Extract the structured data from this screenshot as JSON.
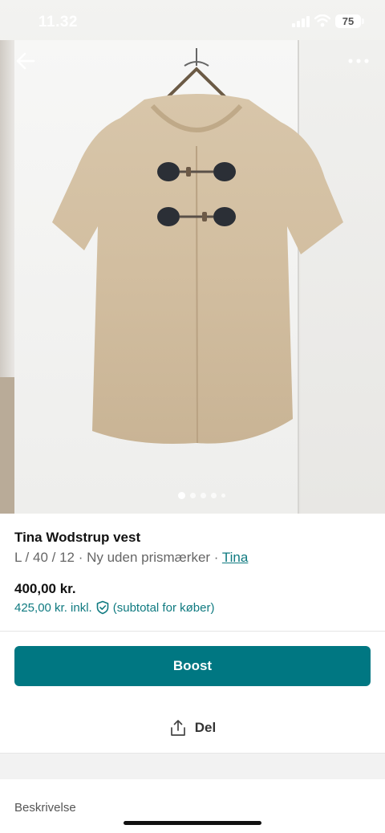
{
  "status_bar": {
    "time": "11.32",
    "battery": "75"
  },
  "gallery": {
    "image_count": 5,
    "active_index": 0
  },
  "item": {
    "title": "Tina Wodstrup vest",
    "meta": "L / 40 / 12 · Ny uden prismærker · ",
    "brand": "Tina",
    "price": "400,00 kr.",
    "price_incl": "425,00 kr. inkl.",
    "price_incl_note": "(subtotal for køber)"
  },
  "actions": {
    "boost_label": "Boost",
    "share_label": "Del"
  },
  "description": {
    "label": "Beskrivelse"
  },
  "icons": {
    "back": "arrow-left-icon",
    "more": "more-horizontal-icon",
    "shield": "shield-check-icon",
    "share": "share-upload-icon"
  },
  "colors": {
    "accent": "#007782",
    "link": "#0f7a80"
  }
}
